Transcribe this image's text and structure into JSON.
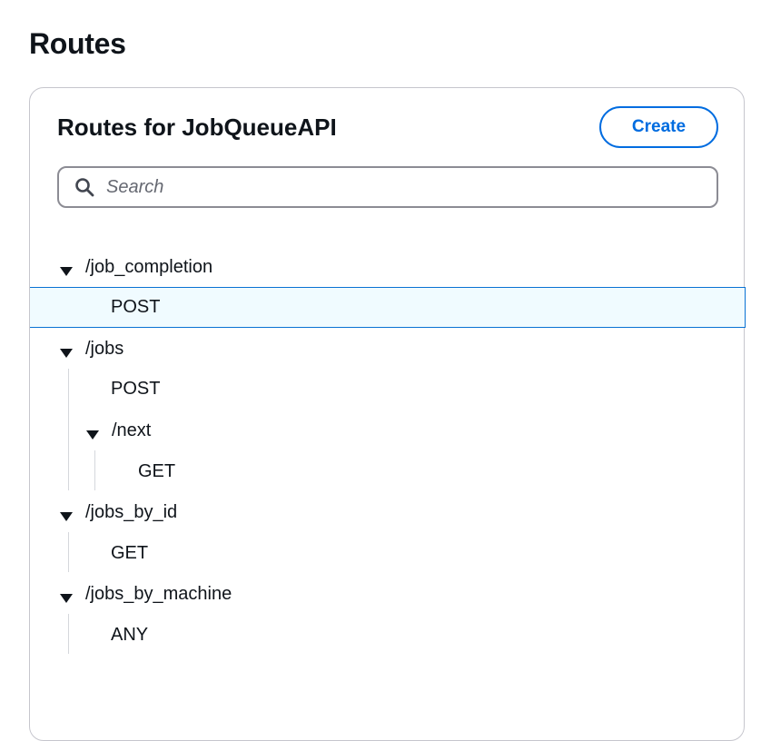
{
  "page": {
    "title": "Routes"
  },
  "panel": {
    "title": "Routes for JobQueueAPI",
    "create_label": "Create",
    "search_placeholder": "Search"
  },
  "routes": [
    {
      "path": "/job_completion",
      "methods": [
        "POST"
      ],
      "selected_method": "POST"
    },
    {
      "path": "/jobs",
      "methods": [
        "POST"
      ],
      "children": [
        {
          "path": "/next",
          "methods": [
            "GET"
          ]
        }
      ]
    },
    {
      "path": "/jobs_by_id",
      "methods": [
        "GET"
      ]
    },
    {
      "path": "/jobs_by_machine",
      "methods": [
        "ANY"
      ]
    }
  ],
  "colors": {
    "accent": "#006ce0",
    "selected_bg": "#f0fbff",
    "border": "#c6c6cd"
  }
}
